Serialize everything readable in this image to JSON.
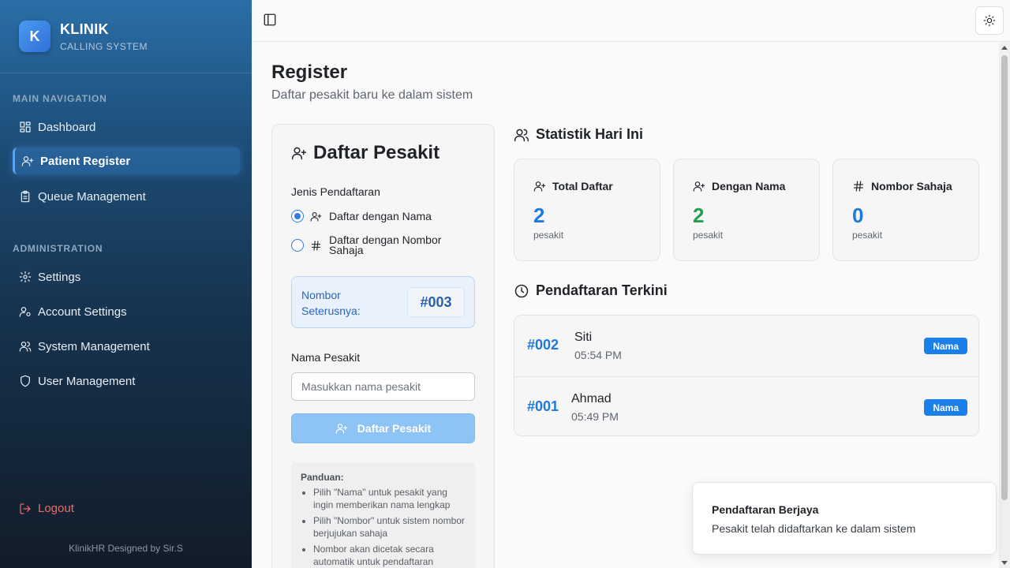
{
  "brand": {
    "logo_letter": "K",
    "title": "KLINIK",
    "subtitle": "CALLING SYSTEM"
  },
  "sidebar": {
    "sections": [
      "MAIN NAVIGATION",
      "ADMINISTRATION"
    ],
    "main_items": [
      {
        "label": "Dashboard",
        "icon": "dashboard-icon"
      },
      {
        "label": "Patient Register",
        "icon": "user-plus-icon",
        "active": true
      },
      {
        "label": "Queue Management",
        "icon": "clipboard-icon"
      }
    ],
    "admin_items": [
      {
        "label": "Settings",
        "icon": "gear-icon"
      },
      {
        "label": "Account Settings",
        "icon": "user-cog-icon"
      },
      {
        "label": "System Management",
        "icon": "users-icon"
      },
      {
        "label": "User Management",
        "icon": "shield-icon"
      }
    ],
    "logout": "Logout",
    "footer": "KlinikHR Designed by Sir.S"
  },
  "page": {
    "title": "Register",
    "subtitle": "Daftar pesakit baru ke dalam sistem"
  },
  "register": {
    "title": "Daftar Pesakit",
    "type_label": "Jenis Pendaftaran",
    "options": [
      {
        "label": "Daftar dengan Nama",
        "checked": true
      },
      {
        "label": "Daftar dengan Nombor Sahaja",
        "checked": false
      }
    ],
    "next_label": "Nombor Seterusnya:",
    "next_number": "#003",
    "name_label": "Nama Pesakit",
    "name_placeholder": "Masukkan nama pesakit",
    "name_value": "",
    "submit_label": "Daftar Pesakit",
    "guide_title": "Panduan:",
    "guide_items": [
      "Pilih \"Nama\" untuk pesakit yang ingin memberikan nama lengkap",
      "Pilih \"Nombor\" untuk sistem nombor berjujukan sahaja",
      "Nombor akan dicetak secara automatik untuk pendaftaran"
    ]
  },
  "stats": {
    "title": "Statistik Hari Ini",
    "cards": [
      {
        "label": "Total Daftar",
        "value": "2",
        "unit": "pesakit",
        "color": "#1f7ae0",
        "icon": "user-plus-icon"
      },
      {
        "label": "Dengan Nama",
        "value": "2",
        "unit": "pesakit",
        "color": "#22a04a",
        "icon": "user-plus-icon"
      },
      {
        "label": "Nombor Sahaja",
        "value": "0",
        "unit": "pesakit",
        "color": "#1f7ae0",
        "icon": "hash-icon"
      }
    ]
  },
  "recent": {
    "title": "Pendaftaran Terkini",
    "rows": [
      {
        "number": "#002",
        "name": "Siti",
        "time": "05:54 PM",
        "badge": "Nama"
      },
      {
        "number": "#001",
        "name": "Ahmad",
        "time": "05:49 PM",
        "badge": "Nama"
      }
    ]
  },
  "toast": {
    "title": "Pendaftaran Berjaya",
    "message": "Pesakit telah didaftarkan ke dalam sistem"
  },
  "colors": {
    "accent": "#2f7ae5",
    "badge": "#1a7fe8",
    "logout": "#f06a6a",
    "green": "#22a04a"
  }
}
